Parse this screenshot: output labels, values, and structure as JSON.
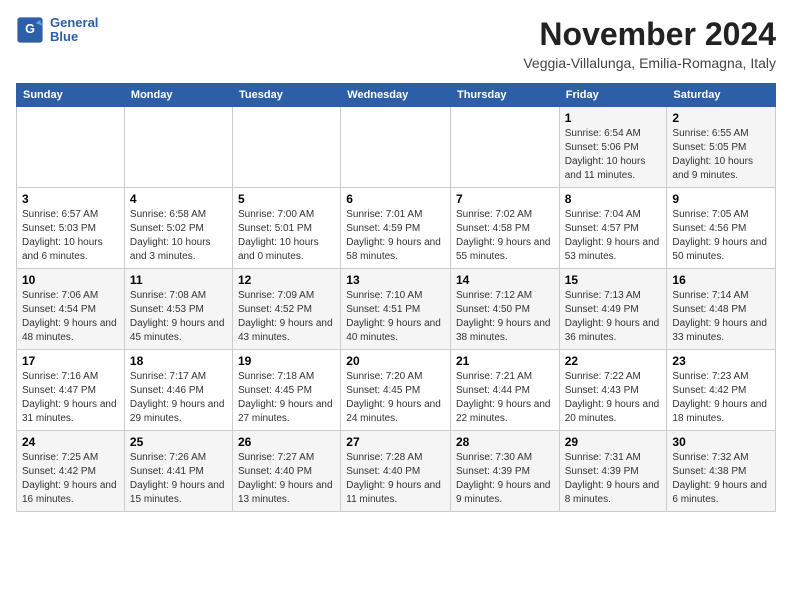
{
  "logo": {
    "line1": "General",
    "line2": "Blue"
  },
  "title": "November 2024",
  "subtitle": "Veggia-Villalunga, Emilia-Romagna, Italy",
  "days_of_week": [
    "Sunday",
    "Monday",
    "Tuesday",
    "Wednesday",
    "Thursday",
    "Friday",
    "Saturday"
  ],
  "weeks": [
    [
      {
        "day": "",
        "info": ""
      },
      {
        "day": "",
        "info": ""
      },
      {
        "day": "",
        "info": ""
      },
      {
        "day": "",
        "info": ""
      },
      {
        "day": "",
        "info": ""
      },
      {
        "day": "1",
        "info": "Sunrise: 6:54 AM\nSunset: 5:06 PM\nDaylight: 10 hours and 11 minutes."
      },
      {
        "day": "2",
        "info": "Sunrise: 6:55 AM\nSunset: 5:05 PM\nDaylight: 10 hours and 9 minutes."
      }
    ],
    [
      {
        "day": "3",
        "info": "Sunrise: 6:57 AM\nSunset: 5:03 PM\nDaylight: 10 hours and 6 minutes."
      },
      {
        "day": "4",
        "info": "Sunrise: 6:58 AM\nSunset: 5:02 PM\nDaylight: 10 hours and 3 minutes."
      },
      {
        "day": "5",
        "info": "Sunrise: 7:00 AM\nSunset: 5:01 PM\nDaylight: 10 hours and 0 minutes."
      },
      {
        "day": "6",
        "info": "Sunrise: 7:01 AM\nSunset: 4:59 PM\nDaylight: 9 hours and 58 minutes."
      },
      {
        "day": "7",
        "info": "Sunrise: 7:02 AM\nSunset: 4:58 PM\nDaylight: 9 hours and 55 minutes."
      },
      {
        "day": "8",
        "info": "Sunrise: 7:04 AM\nSunset: 4:57 PM\nDaylight: 9 hours and 53 minutes."
      },
      {
        "day": "9",
        "info": "Sunrise: 7:05 AM\nSunset: 4:56 PM\nDaylight: 9 hours and 50 minutes."
      }
    ],
    [
      {
        "day": "10",
        "info": "Sunrise: 7:06 AM\nSunset: 4:54 PM\nDaylight: 9 hours and 48 minutes."
      },
      {
        "day": "11",
        "info": "Sunrise: 7:08 AM\nSunset: 4:53 PM\nDaylight: 9 hours and 45 minutes."
      },
      {
        "day": "12",
        "info": "Sunrise: 7:09 AM\nSunset: 4:52 PM\nDaylight: 9 hours and 43 minutes."
      },
      {
        "day": "13",
        "info": "Sunrise: 7:10 AM\nSunset: 4:51 PM\nDaylight: 9 hours and 40 minutes."
      },
      {
        "day": "14",
        "info": "Sunrise: 7:12 AM\nSunset: 4:50 PM\nDaylight: 9 hours and 38 minutes."
      },
      {
        "day": "15",
        "info": "Sunrise: 7:13 AM\nSunset: 4:49 PM\nDaylight: 9 hours and 36 minutes."
      },
      {
        "day": "16",
        "info": "Sunrise: 7:14 AM\nSunset: 4:48 PM\nDaylight: 9 hours and 33 minutes."
      }
    ],
    [
      {
        "day": "17",
        "info": "Sunrise: 7:16 AM\nSunset: 4:47 PM\nDaylight: 9 hours and 31 minutes."
      },
      {
        "day": "18",
        "info": "Sunrise: 7:17 AM\nSunset: 4:46 PM\nDaylight: 9 hours and 29 minutes."
      },
      {
        "day": "19",
        "info": "Sunrise: 7:18 AM\nSunset: 4:45 PM\nDaylight: 9 hours and 27 minutes."
      },
      {
        "day": "20",
        "info": "Sunrise: 7:20 AM\nSunset: 4:45 PM\nDaylight: 9 hours and 24 minutes."
      },
      {
        "day": "21",
        "info": "Sunrise: 7:21 AM\nSunset: 4:44 PM\nDaylight: 9 hours and 22 minutes."
      },
      {
        "day": "22",
        "info": "Sunrise: 7:22 AM\nSunset: 4:43 PM\nDaylight: 9 hours and 20 minutes."
      },
      {
        "day": "23",
        "info": "Sunrise: 7:23 AM\nSunset: 4:42 PM\nDaylight: 9 hours and 18 minutes."
      }
    ],
    [
      {
        "day": "24",
        "info": "Sunrise: 7:25 AM\nSunset: 4:42 PM\nDaylight: 9 hours and 16 minutes."
      },
      {
        "day": "25",
        "info": "Sunrise: 7:26 AM\nSunset: 4:41 PM\nDaylight: 9 hours and 15 minutes."
      },
      {
        "day": "26",
        "info": "Sunrise: 7:27 AM\nSunset: 4:40 PM\nDaylight: 9 hours and 13 minutes."
      },
      {
        "day": "27",
        "info": "Sunrise: 7:28 AM\nSunset: 4:40 PM\nDaylight: 9 hours and 11 minutes."
      },
      {
        "day": "28",
        "info": "Sunrise: 7:30 AM\nSunset: 4:39 PM\nDaylight: 9 hours and 9 minutes."
      },
      {
        "day": "29",
        "info": "Sunrise: 7:31 AM\nSunset: 4:39 PM\nDaylight: 9 hours and 8 minutes."
      },
      {
        "day": "30",
        "info": "Sunrise: 7:32 AM\nSunset: 4:38 PM\nDaylight: 9 hours and 6 minutes."
      }
    ]
  ]
}
